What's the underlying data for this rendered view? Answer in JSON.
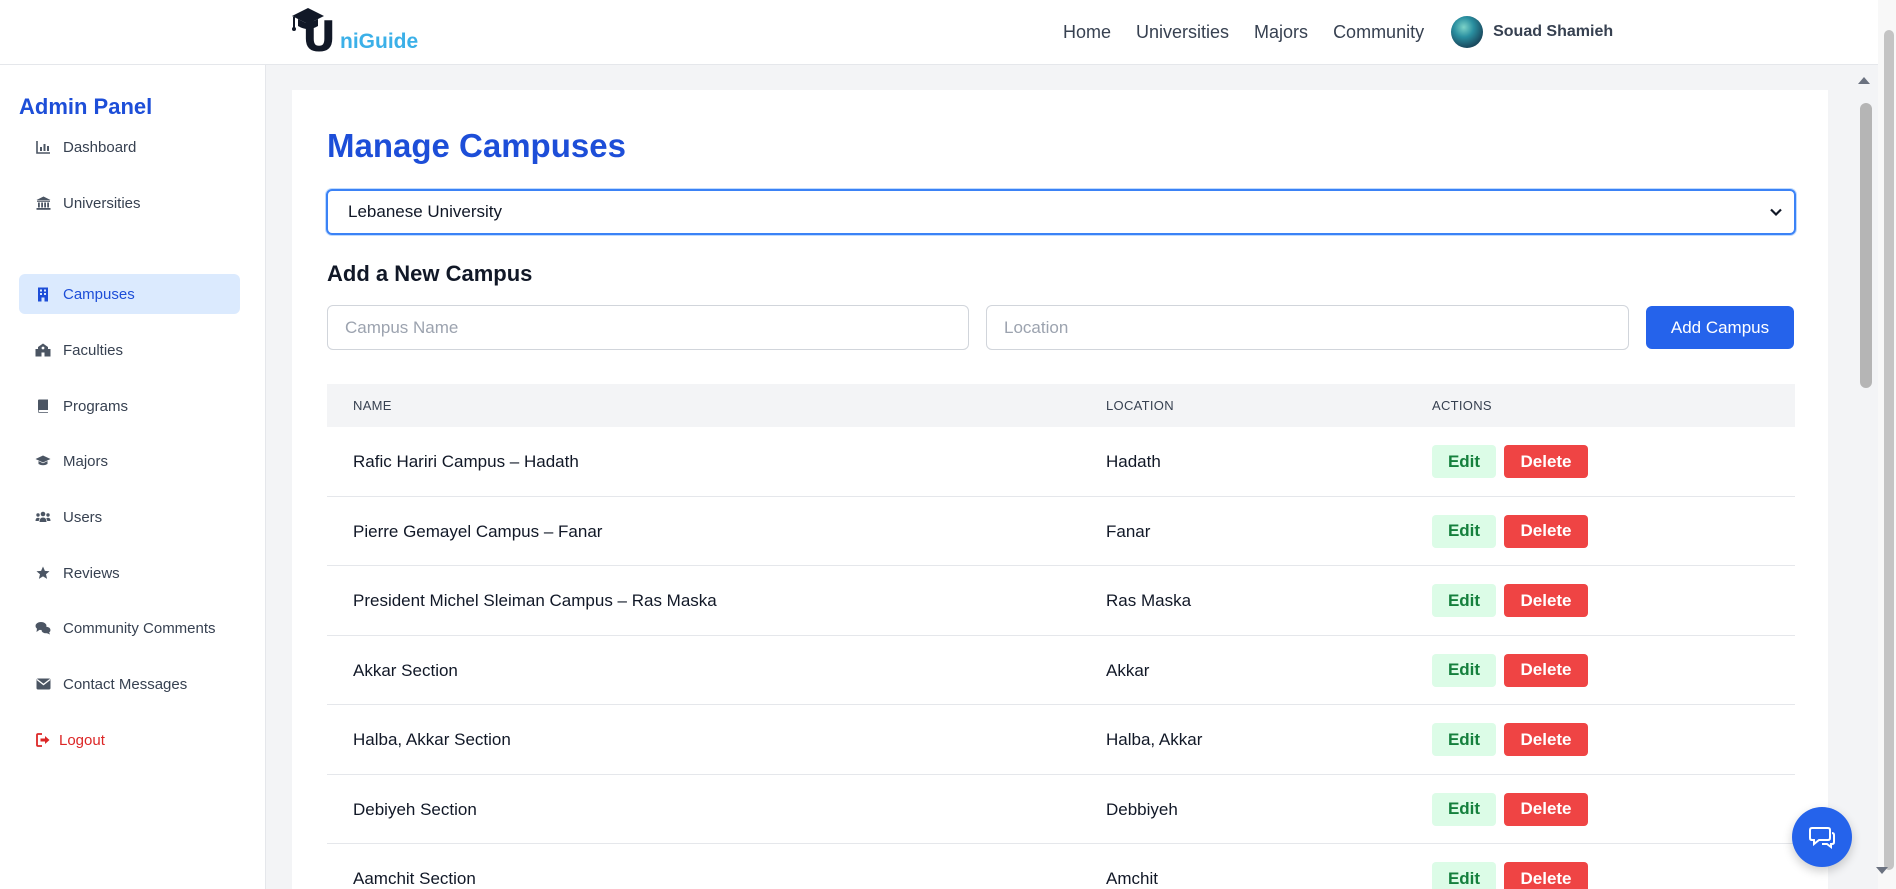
{
  "brand": {
    "logo_initial": "U",
    "logo_rest": "niGuide",
    "logo_text_color": "#3bb0e8"
  },
  "nav": {
    "links": [
      "Home",
      "Universities",
      "Majors",
      "Community"
    ],
    "user_name": "Souad Shamieh"
  },
  "sidebar": {
    "title": "Admin Panel",
    "items": [
      {
        "label": "Dashboard",
        "icon": "chart-bar-icon"
      },
      {
        "label": "Universities",
        "icon": "university-icon"
      },
      {
        "label": "Campuses",
        "icon": "building-icon",
        "active": true
      },
      {
        "label": "Faculties",
        "icon": "school-icon"
      },
      {
        "label": "Programs",
        "icon": "book-icon"
      },
      {
        "label": "Majors",
        "icon": "graduation-cap-icon"
      },
      {
        "label": "Users",
        "icon": "users-icon"
      },
      {
        "label": "Reviews",
        "icon": "star-icon"
      },
      {
        "label": "Community Comments",
        "icon": "comments-icon"
      },
      {
        "label": "Contact Messages",
        "icon": "envelope-icon"
      }
    ],
    "logout_label": "Logout"
  },
  "main": {
    "title": "Manage Campuses",
    "university_select": "Lebanese University",
    "add_section_title": "Add a New Campus",
    "campus_name_placeholder": "Campus Name",
    "location_placeholder": "Location",
    "add_button": "Add Campus",
    "table": {
      "headers": [
        "NAME",
        "LOCATION",
        "ACTIONS"
      ],
      "edit_label": "Edit",
      "delete_label": "Delete",
      "rows": [
        {
          "name": "Rafic Hariri Campus – Hadath",
          "location": "Hadath"
        },
        {
          "name": "Pierre Gemayel Campus – Fanar",
          "location": "Fanar"
        },
        {
          "name": "President Michel Sleiman Campus – Ras Maska",
          "location": "Ras Maska"
        },
        {
          "name": "Akkar Section",
          "location": "Akkar"
        },
        {
          "name": "Halba, Akkar Section",
          "location": "Halba, Akkar"
        },
        {
          "name": "Debiyeh Section",
          "location": "Debbiyeh"
        },
        {
          "name": "Aamchit Section",
          "location": "Amchit"
        }
      ]
    }
  },
  "colors": {
    "primary": "#2563eb",
    "title_blue": "#1d4ed8",
    "active_bg": "#dbeafe",
    "edit_bg": "#dcfce7",
    "edit_text": "#15803d",
    "delete_bg": "#ef4444",
    "logout_red": "#dc2626"
  }
}
